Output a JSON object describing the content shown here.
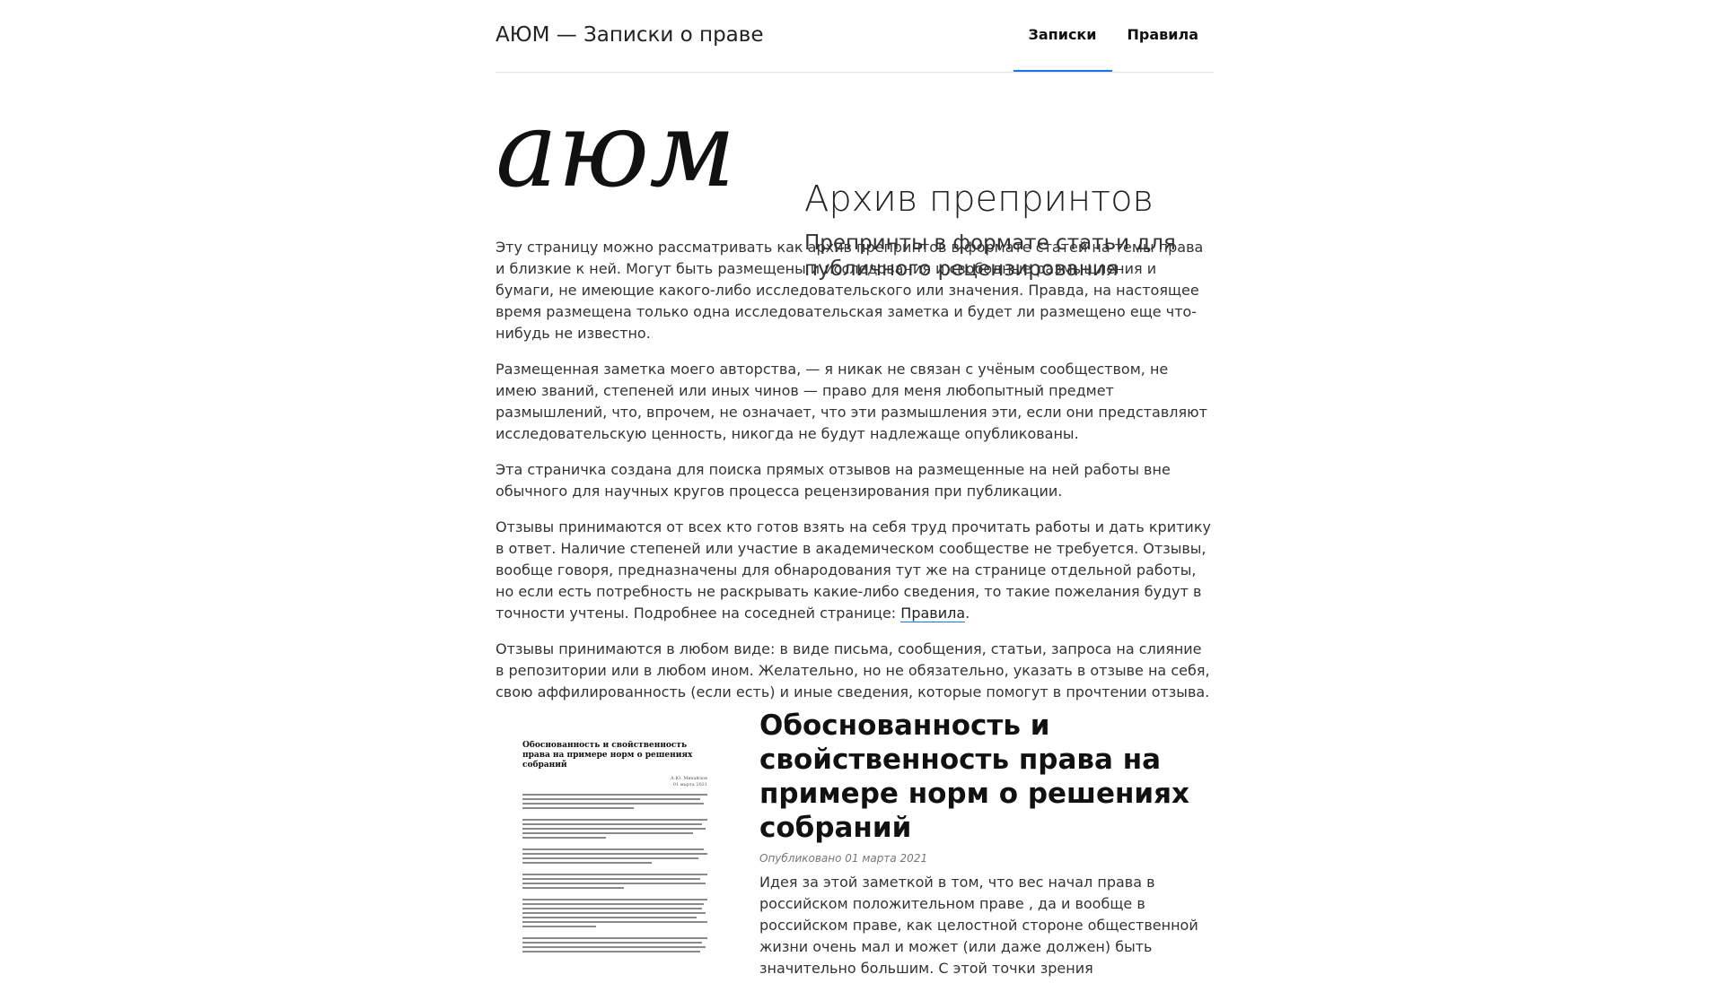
{
  "header": {
    "site_title": "АЮМ — Записки о праве",
    "nav": [
      {
        "label": "Записки",
        "active": true
      },
      {
        "label": "Правила",
        "active": false
      }
    ],
    "accent_color": "#1a73e8"
  },
  "hero": {
    "logo_text": "аюм",
    "title": "Архив препринтов",
    "subtitle": "Препринты в формате статьи для публичного рецензирования"
  },
  "intro": {
    "p1": "Эту страницу можно рассматривать как архив препринтов в формате статей на темы права и близкие к ней. Могут быть размещены и исследования и свободные размышления и бумаги, не имеющие какого-либо исследовательского или значения. Правда, на настоящее время размещена только одна исследовательская заметка и будет ли размещено еще что-нибудь не известно.",
    "p2": "Размещенная заметка моего авторства, — я никак не связан с учёным сообществом, не имею званий, степеней или иных чинов — право для меня любопытный предмет размышлений, что, впрочем, не означает, что эти размышления эти, если они представляют исследовательскую ценность, никогда не будут надлежаще опубликованы.",
    "p3": "Эта страничка создана для поиска прямых отзывов на размещенные на ней работы вне обычного для научных кругов процесса рецензирования при публикации.",
    "p4_text": "Отзывы принимаются от всех кто готов взять на себя труд прочитать работы и дать критику в ответ. Наличие степеней или участие в академическом сообществе не требуется. Отзывы, вообще говоря, предназначены для обнародования тут же на странице отдельной работы, но если есть потребность не раскрывать какие-либо сведения, то такие пожелания будут в точности учтены. Подробнее на соседней странице: ",
    "p4_link": "Правила",
    "p4_end": ".",
    "p5": "Отзывы принимаются в любом виде: в виде письма, сообщения, статьи, запроса на слияние в репозитории или в любом ином. Желательно, но не обязательно, указать в отзыве на себя, свою аффилированность (если есть) и иные сведения, которые помогут в прочтении отзыва."
  },
  "article": {
    "thumb_title": "Обоснованность и свойственность права на примере норм о решениях собраний",
    "thumb_author": "А.Ю. Михайлов",
    "thumb_date": "01 марта 2021",
    "title": "Обоснованность и свойственность права на примере норм о решениях собраний",
    "date": "Опубликовано 01 марта 2021",
    "body": "Идея за этой заметкой в том, что вес начал права в российском положительном праве , да и вообще в российском праве, как целостной стороне общественной жизни очень мал и может (или даже должен) быть значительно большим. С этой точки зрения"
  }
}
